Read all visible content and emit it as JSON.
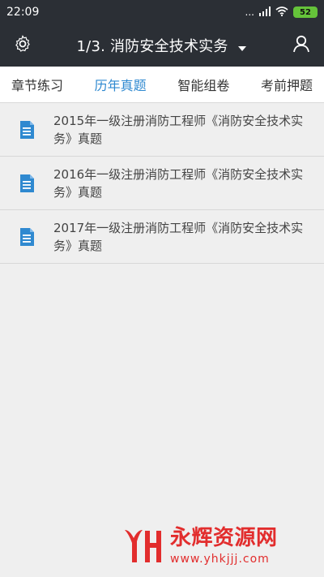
{
  "status_bar": {
    "time": "22:09",
    "signal_dots": "...",
    "battery": "52"
  },
  "app_bar": {
    "title": "1/3. 消防安全技术实务",
    "left_icon": "gear-icon",
    "right_icon": "user-icon",
    "dropdown_icon": "caret-down-icon"
  },
  "tabs": [
    {
      "label": "章节练习",
      "active": false
    },
    {
      "label": "历年真题",
      "active": true
    },
    {
      "label": "智能组卷",
      "active": false
    },
    {
      "label": "考前押题",
      "active": false
    }
  ],
  "items": [
    {
      "title": "2015年一级注册消防工程师《消防安全技术实务》真题",
      "icon": "document-icon"
    },
    {
      "title": "2016年一级注册消防工程师《消防安全技术实务》真题",
      "icon": "document-icon"
    },
    {
      "title": "2017年一级注册消防工程师《消防安全技术实务》真题",
      "icon": "document-icon"
    }
  ],
  "watermark": {
    "title": "永辉资源网",
    "url": "www.yhkjjj.com"
  },
  "colors": {
    "appbar_bg": "#2b2f35",
    "tab_active": "#2f89d0",
    "doc_icon": "#2f89d0",
    "watermark": "#e22d2d"
  }
}
